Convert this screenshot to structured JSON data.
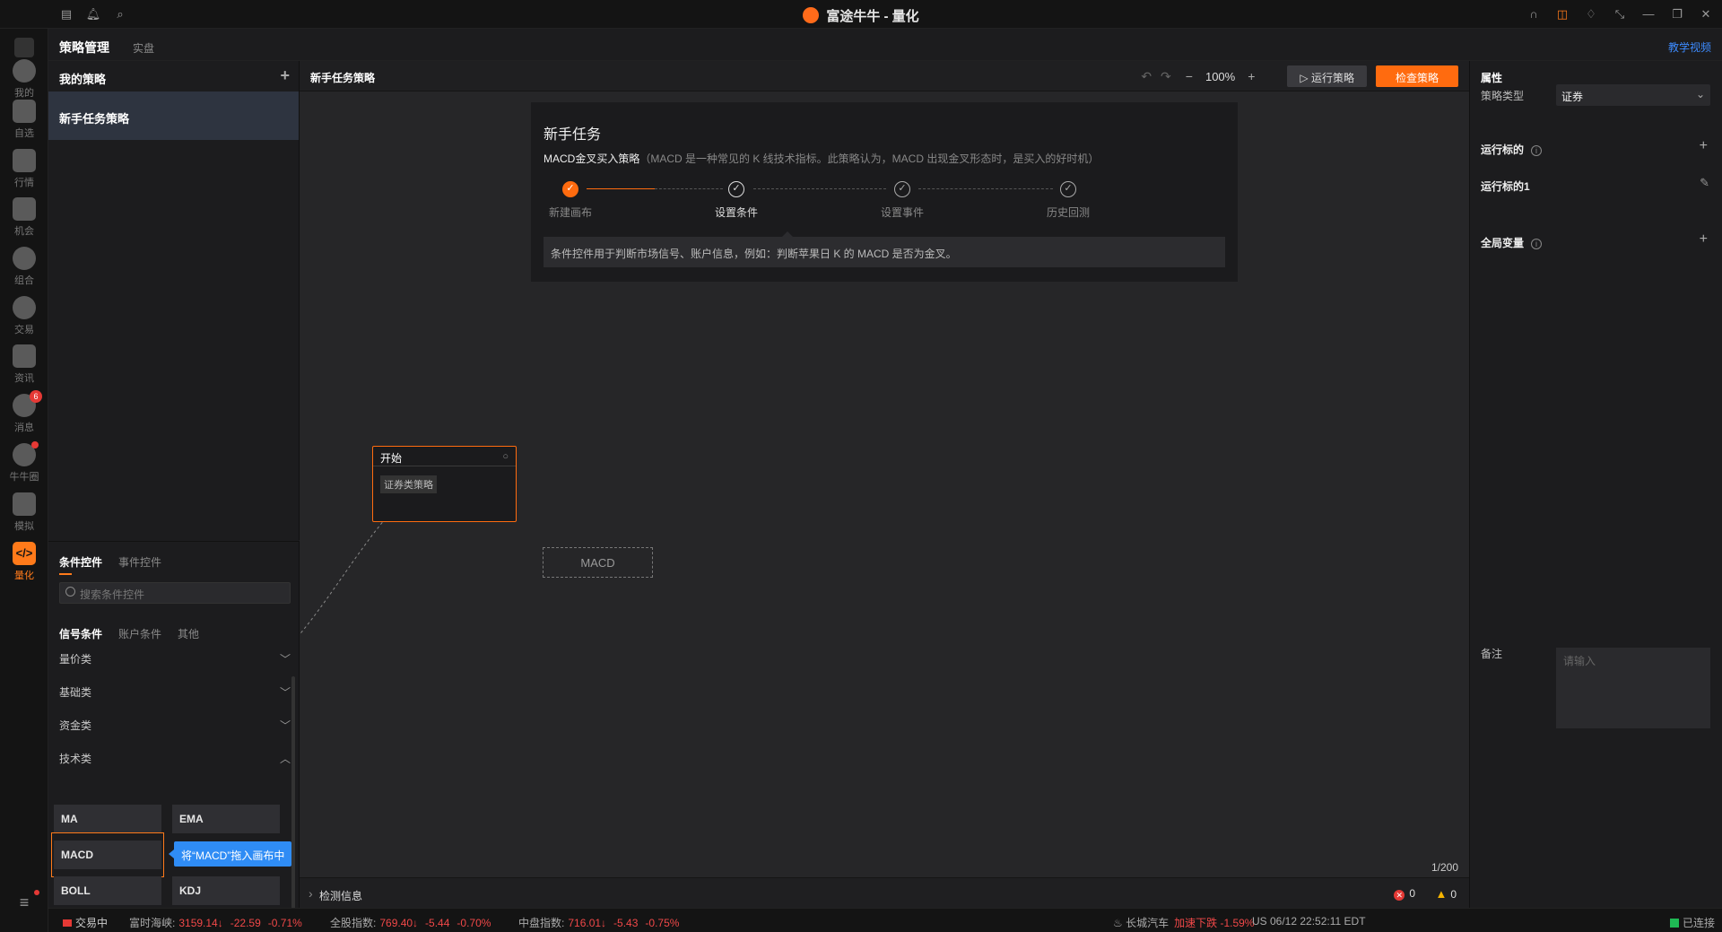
{
  "window": {
    "title": "富途牛牛 - 量化"
  },
  "nav": {
    "items": [
      {
        "label": "我的"
      },
      {
        "label": "自选"
      },
      {
        "label": "行情"
      },
      {
        "label": "机会"
      },
      {
        "label": "组合"
      },
      {
        "label": "交易"
      },
      {
        "label": "资讯"
      },
      {
        "label": "消息",
        "badge": "6"
      },
      {
        "label": "牛牛圈"
      },
      {
        "label": "模拟"
      },
      {
        "label": "量化"
      }
    ],
    "active_glyph": "</>"
  },
  "tabs": {
    "manage": "策略管理",
    "live": "实盘",
    "tutorial": "教学视频"
  },
  "strategies": {
    "header": "我的策略",
    "items": [
      "新手任务策略"
    ]
  },
  "conditions": {
    "tabs": [
      "条件控件",
      "事件控件"
    ],
    "search_placeholder": "搜索条件控件",
    "subtabs": [
      "信号条件",
      "账户条件",
      "其他"
    ],
    "categories": [
      "量价类",
      "基础类",
      "资金类",
      "技术类"
    ],
    "tiles": [
      "MA",
      "EMA",
      "MACD",
      "BOLL",
      "KDJ"
    ],
    "drag_tip": "将“MACD”拖入画布中"
  },
  "canvas": {
    "title": "新手任务策略",
    "zoom": "100%",
    "run_label": "运行策略",
    "check_label": "检查策略",
    "page_count": "1/200"
  },
  "task": {
    "title": "新手任务",
    "desc_bold": "MACD金叉买入策略",
    "desc_note": "（MACD 是一种常见的 K 线技术指标。此策略认为，MACD 出现金叉形态时，是买入的好时机）",
    "steps": [
      "新建画布",
      "设置条件",
      "设置事件",
      "历史回测"
    ],
    "hint": "条件控件用于判断市场信号、账户信息，例如：判断苹果日 K 的 MACD 是否为金叉。"
  },
  "nodes": {
    "start_title": "开始",
    "start_tag": "证券类策略",
    "ghost_label": "MACD"
  },
  "detect": {
    "label": "检测信息",
    "errors": "0",
    "warnings": "0"
  },
  "props": {
    "title": "属性",
    "type_label": "策略类型",
    "type_value": "证券",
    "targets_label": "运行标的",
    "target_item": "运行标的1",
    "globals_label": "全局变量",
    "note_label": "备注",
    "note_placeholder": "请输入"
  },
  "status": {
    "trading": "交易中",
    "indices": [
      {
        "name": "富时海峡:",
        "value": "3159.14↓",
        "change": "-22.59",
        "pct": "-0.71%"
      },
      {
        "name": "全股指数:",
        "value": "769.40↓",
        "change": "-5.44",
        "pct": "-0.70%"
      },
      {
        "name": "中盘指数:",
        "value": "716.01↓",
        "change": "-5.43",
        "pct": "-0.75%"
      }
    ],
    "news_name": "长城汽车",
    "news_text": "加速下跌 -1.59%",
    "clock": "US 06/12 22:52:11 EDT",
    "connection": "已连接"
  },
  "colors": {
    "accent": "#ff6b0f",
    "tip_blue": "#2f8cf5",
    "down_red": "#f04848"
  }
}
